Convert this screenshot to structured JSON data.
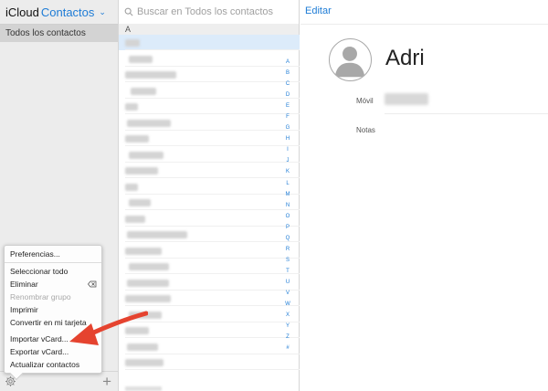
{
  "sidebar": {
    "brand": "iCloud",
    "app": "Contactos",
    "group_label": "Todos los contactos"
  },
  "menu": {
    "items": [
      {
        "label": "Preferencias...",
        "enabled": true
      },
      {
        "label": "Seleccionar todo",
        "enabled": true
      },
      {
        "label": "Eliminar",
        "enabled": true
      },
      {
        "label": "Renombrar grupo",
        "enabled": false
      },
      {
        "label": "Imprimir",
        "enabled": true
      },
      {
        "label": "Convertir en mi tarjeta",
        "enabled": true
      },
      {
        "label": "Importar vCard...",
        "enabled": true
      },
      {
        "label": "Exportar vCard...",
        "enabled": true
      },
      {
        "label": "Actualizar contactos",
        "enabled": true
      }
    ]
  },
  "list": {
    "search_placeholder": "Buscar en Todos los contactos",
    "section_letter": "A",
    "index_letters": [
      "A",
      "B",
      "C",
      "D",
      "E",
      "F",
      "G",
      "H",
      "I",
      "J",
      "K",
      "L",
      "M",
      "N",
      "O",
      "P",
      "Q",
      "R",
      "S",
      "T",
      "U",
      "V",
      "W",
      "X",
      "Y",
      "Z",
      "#"
    ]
  },
  "detail": {
    "edit_label": "Editar",
    "name": "Adri",
    "mobile_label": "Móvil",
    "notes_label": "Notas"
  },
  "colors": {
    "accent": "#1e7cd6",
    "arrow": "#e5432f",
    "selected_row": "#dcebfa"
  }
}
